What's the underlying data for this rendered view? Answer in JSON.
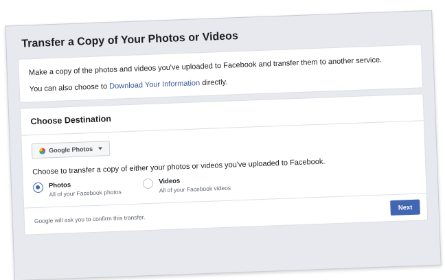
{
  "page": {
    "title": "Transfer a Copy of Your Photos or Videos"
  },
  "intro": {
    "line1": "Make a copy of the photos and videos you've uploaded to Facebook and transfer them to another service.",
    "line2_prefix": "You can also choose to ",
    "line2_link": "Download Your Information",
    "line2_suffix": " directly."
  },
  "destination": {
    "header": "Choose Destination",
    "dropdown": {
      "selected": "Google Photos",
      "icon": "google-photos-icon"
    },
    "prompt": "Choose to transfer a copy of either your photos or videos you've uploaded to Facebook.",
    "options": [
      {
        "label": "Photos",
        "description": "All of your Facebook photos",
        "selected": true
      },
      {
        "label": "Videos",
        "description": "All of your Facebook videos",
        "selected": false
      }
    ],
    "footer_note": "Google will ask you to confirm this transfer.",
    "next_label": "Next"
  },
  "colors": {
    "accent": "#4267b2",
    "link": "#385898",
    "backdrop": "#e7e9ee"
  }
}
